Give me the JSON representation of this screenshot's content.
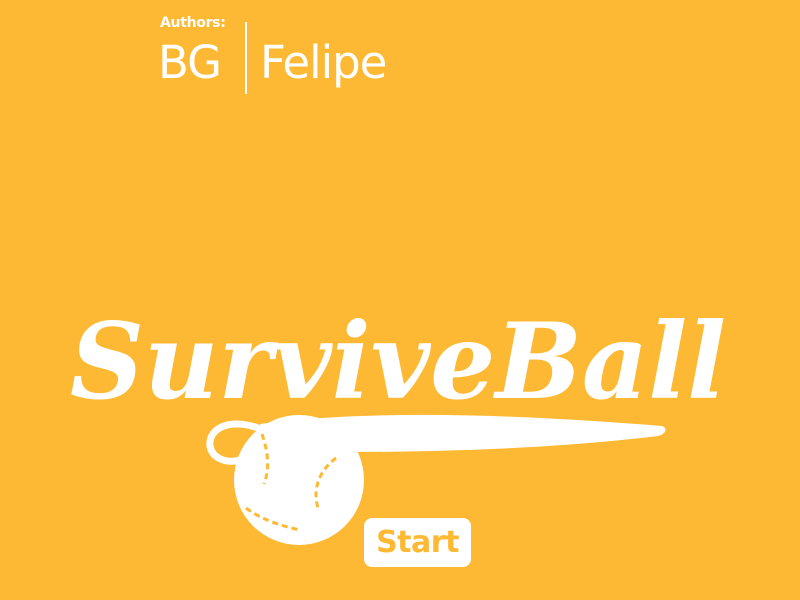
{
  "authors": {
    "label": "Authors:",
    "names": [
      "BG",
      "Felipe"
    ]
  },
  "logo": {
    "title": "SurviveBall",
    "icon": "tennis-ball-icon"
  },
  "start_button": {
    "label": "Start"
  },
  "colors": {
    "background": "#FDB933",
    "foreground": "#FFFFFF"
  }
}
